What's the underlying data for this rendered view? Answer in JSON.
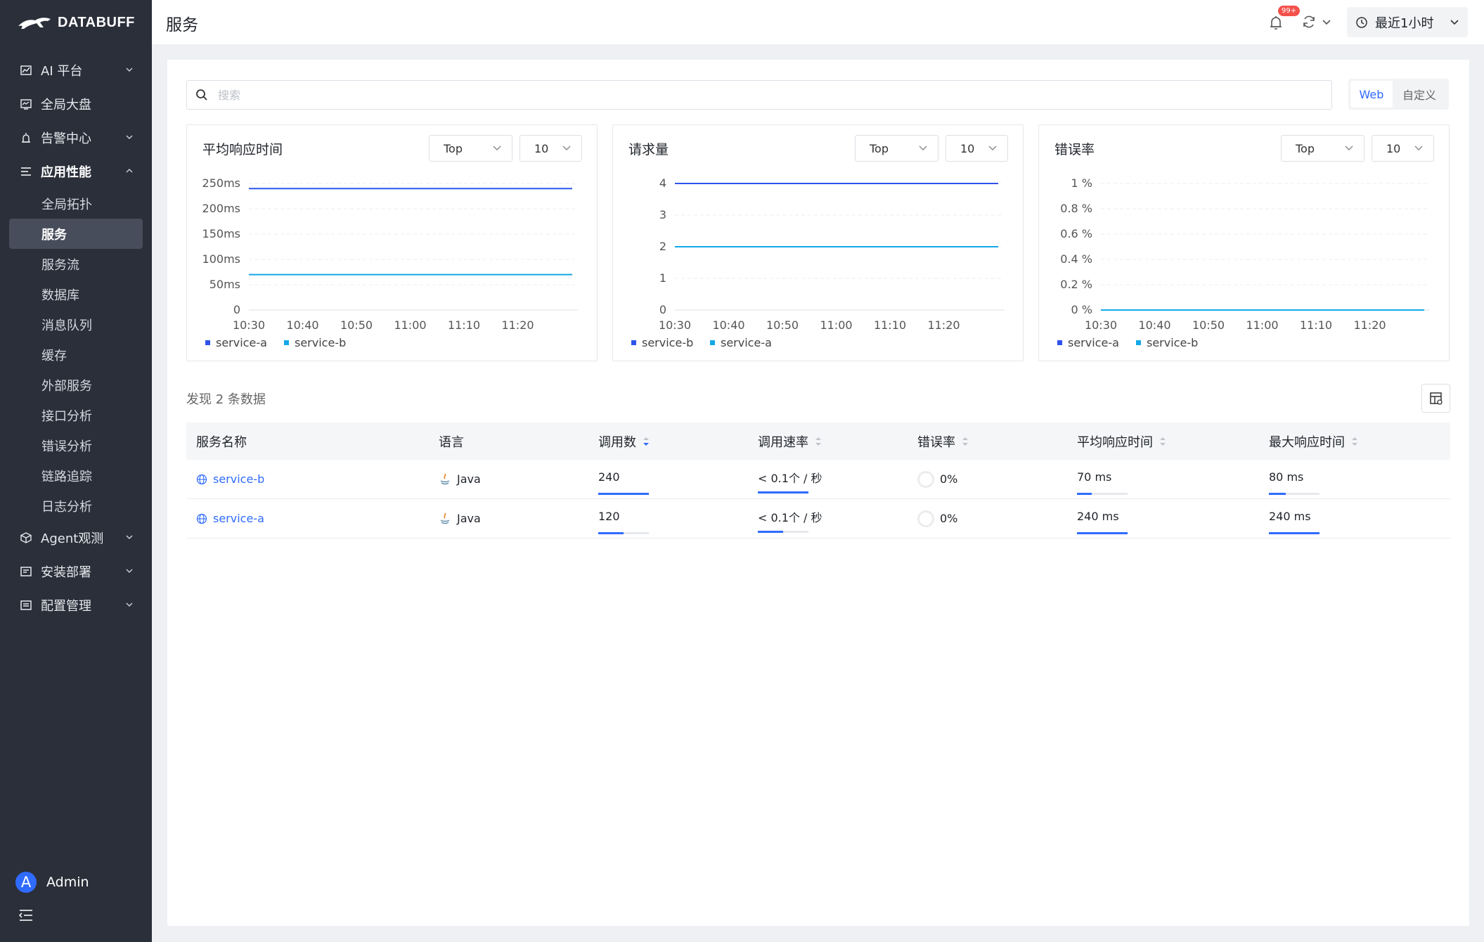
{
  "app": {
    "logo_text": "DATABUFF"
  },
  "sidebar": {
    "items": [
      {
        "label": "AI 平台",
        "icon": "chart-line-icon",
        "expandable": true
      },
      {
        "label": "全局大盘",
        "icon": "dashboard-icon",
        "expandable": false
      },
      {
        "label": "告警中心",
        "icon": "alarm-icon",
        "expandable": true
      },
      {
        "label": "应用性能",
        "icon": "list-icon",
        "expandable": true,
        "open": true
      }
    ],
    "sub_items": [
      "全局拓扑",
      "服务",
      "服务流",
      "数据库",
      "消息队列",
      "缓存",
      "外部服务",
      "接口分析",
      "错误分析",
      "链路追踪",
      "日志分析"
    ],
    "active_sub": "服务",
    "items_after": [
      {
        "label": "Agent观测",
        "icon": "cube-icon"
      },
      {
        "label": "安装部署",
        "icon": "install-icon"
      },
      {
        "label": "配置管理",
        "icon": "config-icon"
      }
    ],
    "user": {
      "initial": "A",
      "name": "Admin"
    }
  },
  "header": {
    "title": "服务",
    "notification_count": "99+",
    "time_range": "最近1小时"
  },
  "search": {
    "placeholder": "搜索"
  },
  "view_toggle": {
    "options": [
      "Web",
      "自定义"
    ],
    "active": "Web"
  },
  "cards": [
    {
      "title": "平均响应时间",
      "top_select": "Top",
      "count_select": "10"
    },
    {
      "title": "请求量",
      "top_select": "Top",
      "count_select": "10"
    },
    {
      "title": "错误率",
      "top_select": "Top",
      "count_select": "10"
    }
  ],
  "chart_data": [
    {
      "type": "line",
      "title": "平均响应时间",
      "x": [
        "10:30",
        "10:40",
        "10:50",
        "11:00",
        "11:10",
        "11:20"
      ],
      "ytick_labels": [
        "0",
        "50ms",
        "100ms",
        "150ms",
        "200ms",
        "250ms"
      ],
      "ylim": [
        0,
        250
      ],
      "grid": true,
      "legend_position": "bottom-left",
      "series": [
        {
          "name": "service-a",
          "color": "#2f54eb",
          "values": [
            240,
            240,
            240,
            240,
            240,
            240
          ]
        },
        {
          "name": "service-b",
          "color": "#13a8e8",
          "values": [
            70,
            70,
            70,
            70,
            70,
            70
          ]
        }
      ]
    },
    {
      "type": "line",
      "title": "请求量",
      "x": [
        "10:30",
        "10:40",
        "10:50",
        "11:00",
        "11:10",
        "11:20"
      ],
      "ytick_labels": [
        "0",
        "1",
        "2",
        "3",
        "4"
      ],
      "ylim": [
        0,
        4
      ],
      "grid": true,
      "legend_position": "bottom-left",
      "series": [
        {
          "name": "service-b",
          "color": "#2f54eb",
          "values": [
            4,
            4,
            4,
            4,
            4,
            4
          ]
        },
        {
          "name": "service-a",
          "color": "#13a8e8",
          "values": [
            2,
            2,
            2,
            2,
            2,
            2
          ]
        }
      ]
    },
    {
      "type": "line",
      "title": "错误率",
      "x": [
        "10:30",
        "10:40",
        "10:50",
        "11:00",
        "11:10",
        "11:20"
      ],
      "ytick_labels": [
        "0 %",
        "0.2 %",
        "0.4 %",
        "0.6 %",
        "0.8 %",
        "1 %"
      ],
      "ylim": [
        0,
        1
      ],
      "grid": true,
      "legend_position": "bottom-left",
      "series": [
        {
          "name": "service-a",
          "color": "#2f54eb",
          "values": [
            0,
            0,
            0,
            0,
            0,
            0
          ]
        },
        {
          "name": "service-b",
          "color": "#13a8e8",
          "values": [
            0,
            0,
            0,
            0,
            0,
            0
          ]
        }
      ]
    }
  ],
  "table": {
    "count_text": "发现 2 条数据",
    "columns": [
      "服务名称",
      "语言",
      "调用数",
      "调用速率",
      "错误率",
      "平均响应时间",
      "最大响应时间"
    ],
    "rows": [
      {
        "name": "service-b",
        "language": "Java",
        "calls": "240",
        "calls_frac": 1.0,
        "rate": "< 0.1个 / 秒",
        "rate_frac": 1.0,
        "error": "0%",
        "avg": "70 ms",
        "avg_frac": 0.29,
        "max": "80 ms",
        "max_frac": 0.33
      },
      {
        "name": "service-a",
        "language": "Java",
        "calls": "120",
        "calls_frac": 0.5,
        "rate": "< 0.1个 / 秒",
        "rate_frac": 0.5,
        "error": "0%",
        "avg": "240 ms",
        "avg_frac": 1.0,
        "max": "240 ms",
        "max_frac": 1.0
      }
    ]
  }
}
